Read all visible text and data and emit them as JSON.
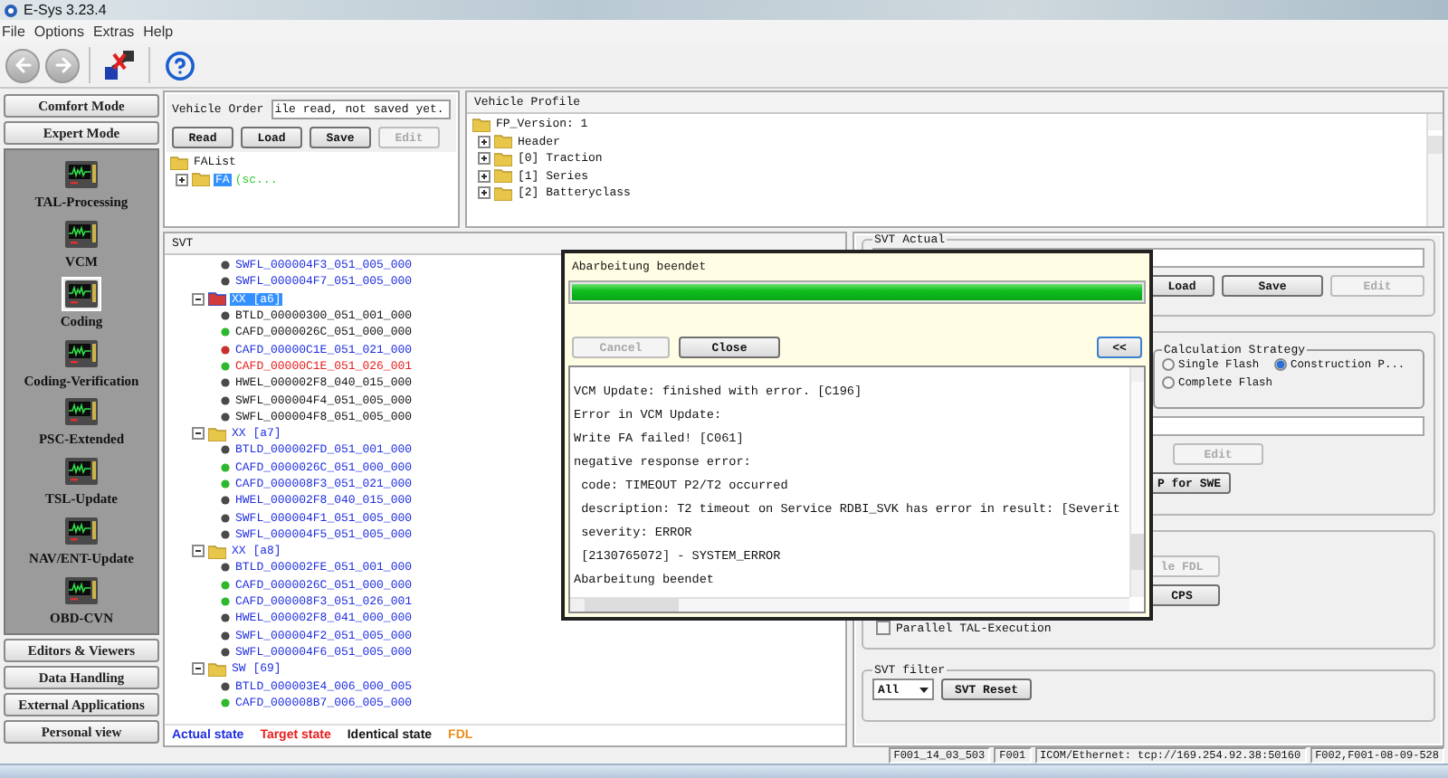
{
  "window": {
    "title": "E-Sys 3.23.4"
  },
  "menu": [
    "File",
    "Options",
    "Extras",
    "Help"
  ],
  "toolbar": [
    {
      "kind": "back",
      "disabled": true
    },
    {
      "kind": "forward",
      "disabled": true
    },
    {
      "kind": "connect"
    },
    {
      "kind": "help"
    }
  ],
  "sidebar": {
    "top_buttons": [
      "Comfort Mode",
      "Expert Mode"
    ],
    "tools": [
      {
        "label": "TAL-Processing",
        "selected": false
      },
      {
        "label": "VCM",
        "selected": false
      },
      {
        "label": "Coding",
        "selected": true
      },
      {
        "label": "Coding-Verification",
        "selected": false
      },
      {
        "label": "PSC-Extended",
        "selected": false
      },
      {
        "label": "TSL-Update",
        "selected": false
      },
      {
        "label": "NAV/ENT-Update",
        "selected": false
      },
      {
        "label": "OBD-CVN",
        "selected": false
      }
    ],
    "bottom_buttons": [
      "Editors & Viewers",
      "Data Handling",
      "External Applications",
      "Personal view"
    ]
  },
  "vehicle_order": {
    "label": "Vehicle Order",
    "value": "ile read, not saved yet.",
    "buttons": [
      {
        "label": "Read",
        "disabled": false
      },
      {
        "label": "Load",
        "disabled": false
      },
      {
        "label": "Save",
        "disabled": false
      },
      {
        "label": "Edit",
        "disabled": true
      }
    ],
    "tree": {
      "label": "FAList",
      "children": [
        {
          "label": "FA",
          "note": "(sc...",
          "selected": true,
          "expanded": false
        }
      ]
    }
  },
  "vehicle_profile": {
    "title": "Vehicle Profile",
    "tree": {
      "label": "FP_Version: 1",
      "children": [
        {
          "label": "Header",
          "expanded": false
        },
        {
          "label": "[0] Traction",
          "expanded": false
        },
        {
          "label": "[1] Series",
          "expanded": false
        },
        {
          "label": "[2] Batteryclass",
          "expanded": false
        }
      ]
    }
  },
  "svt": {
    "title": "SVT",
    "items": [
      {
        "kind": "actual",
        "label": "SWFL_000004F3_051_005_000",
        "color": "#4a4a4a"
      },
      {
        "kind": "actual",
        "label": "SWFL_000004F7_051_005_000",
        "color": "#4a4a4a"
      },
      {
        "kind": "group",
        "label": "XX [a6]",
        "selected": true,
        "expanded": true,
        "children": [
          {
            "kind": "identical",
            "label": "BTLD_00000300_051_001_000",
            "color": "#4a4a4a"
          },
          {
            "kind": "identical",
            "label": "CAFD_0000026C_051_000_000",
            "color": "#2eb82e"
          },
          {
            "kind": "actual",
            "label": "CAFD_00000C1E_051_021_000",
            "color": "#c83030"
          },
          {
            "kind": "target",
            "label": "CAFD_00000C1E_051_026_001",
            "color": "#2eb82e"
          },
          {
            "kind": "identical",
            "label": "HWEL_000002F8_040_015_000",
            "color": "#4a4a4a"
          },
          {
            "kind": "identical",
            "label": "SWFL_000004F4_051_005_000",
            "color": "#4a4a4a"
          },
          {
            "kind": "identical",
            "label": "SWFL_000004F8_051_005_000",
            "color": "#4a4a4a"
          }
        ]
      },
      {
        "kind": "group",
        "label": "XX [a7]",
        "selected": false,
        "expanded": true,
        "children": [
          {
            "kind": "actual",
            "label": "BTLD_000002FD_051_001_000",
            "color": "#4a4a4a"
          },
          {
            "kind": "actual",
            "label": "CAFD_0000026C_051_000_000",
            "color": "#2eb82e"
          },
          {
            "kind": "actual",
            "label": "CAFD_000008F3_051_021_000",
            "color": "#2eb82e"
          },
          {
            "kind": "actual",
            "label": "HWEL_000002F8_040_015_000",
            "color": "#4a4a4a"
          },
          {
            "kind": "actual",
            "label": "SWFL_000004F1_051_005_000",
            "color": "#4a4a4a"
          },
          {
            "kind": "actual",
            "label": "SWFL_000004F5_051_005_000",
            "color": "#4a4a4a"
          }
        ]
      },
      {
        "kind": "group",
        "label": "XX [a8]",
        "selected": false,
        "expanded": true,
        "children": [
          {
            "kind": "actual",
            "label": "BTLD_000002FE_051_001_000",
            "color": "#4a4a4a"
          },
          {
            "kind": "actual",
            "label": "CAFD_0000026C_051_000_000",
            "color": "#2eb82e"
          },
          {
            "kind": "actual",
            "label": "CAFD_000008F3_051_026_001",
            "color": "#2eb82e"
          },
          {
            "kind": "actual",
            "label": "HWEL_000002F8_041_000_000",
            "color": "#4a4a4a"
          },
          {
            "kind": "actual",
            "label": "SWFL_000004F2_051_005_000",
            "color": "#4a4a4a"
          },
          {
            "kind": "actual",
            "label": "SWFL_000004F6_051_005_000",
            "color": "#4a4a4a"
          }
        ]
      },
      {
        "kind": "group",
        "label": "SW [69]",
        "selected": false,
        "expanded": true,
        "children": [
          {
            "kind": "actual",
            "label": "BTLD_000003E4_006_000_005",
            "color": "#4a4a4a"
          },
          {
            "kind": "actual",
            "label": "CAFD_000008B7_006_005_000",
            "color": "#2eb82e"
          }
        ]
      }
    ],
    "legend": [
      {
        "label": "Actual state",
        "kind": "actual"
      },
      {
        "label": "Target state",
        "kind": "target"
      },
      {
        "label": "Identical state",
        "kind": "identical"
      },
      {
        "label": "FDL",
        "kind": "fdl"
      }
    ]
  },
  "svt_actual": {
    "title": "SVT Actual",
    "buttons": [
      {
        "label": "Load",
        "disabled": false
      },
      {
        "label": "Save",
        "disabled": false
      },
      {
        "label": "Edit",
        "disabled": true
      }
    ]
  },
  "calculation": {
    "title": "Calculation Strategy",
    "options": [
      {
        "label": "Single Flash",
        "selected": false
      },
      {
        "label": "Construction P...",
        "selected": true
      },
      {
        "label": "Complete Flash",
        "selected": false
      }
    ],
    "edit_button": {
      "label": "Edit",
      "disabled": true
    },
    "swe_button": {
      "label": "P for SWE",
      "disabled": false
    }
  },
  "execution": {
    "buttons": [
      {
        "label": "le FDL",
        "disabled": true
      },
      {
        "label": "CPS",
        "disabled": false
      }
    ],
    "checkbox": {
      "label": "Parallel TAL-Execution",
      "checked": false
    }
  },
  "svt_filter": {
    "title": "SVT filter",
    "value": "All",
    "button": "SVT Reset"
  },
  "dialog": {
    "title": "Abarbeitung beendet",
    "level": 1,
    "buttons": [
      {
        "label": "Cancel",
        "disabled": true
      },
      {
        "label": "Close",
        "disabled": false
      }
    ],
    "toggle": "<<",
    "log": [
      "VCM Update: finished with error. [C196]",
      "Error in VCM Update:",
      "Write FA failed! [C061]",
      "negative response error:",
      " code: TIMEOUT P2/T2 occurred",
      " description: T2 timeout on Service RDBI_SVK has error in result: [Severit",
      " severity: ERROR",
      " [2130765072] - SYSTEM_ERROR",
      "Abarbeitung beendet"
    ]
  },
  "status_bar": [
    "F001_14_03_503",
    "F001",
    "ICOM/Ethernet: tcp://169.254.92.38:50160",
    "F002,F001-08-09-528"
  ]
}
